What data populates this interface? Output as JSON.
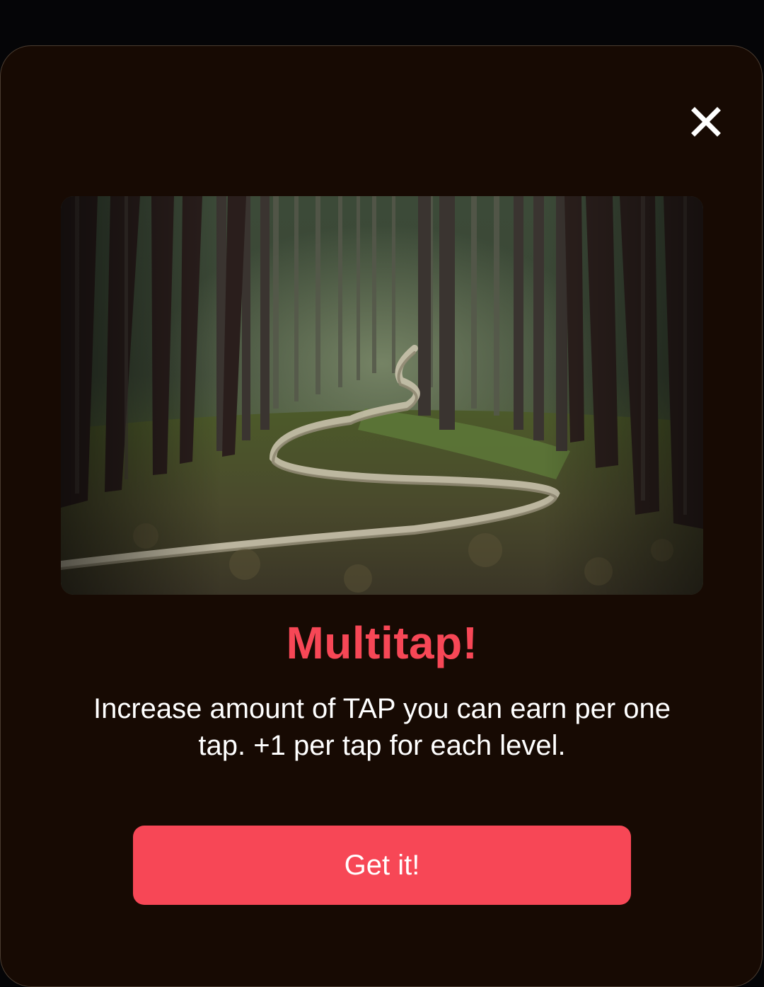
{
  "dialog": {
    "close_icon": "close-icon",
    "image_description_icon": "forest-path-image",
    "title": "Multitap!",
    "description": "Increase amount of TAP you can earn per one tap. +1 per tap for each level.",
    "cta_label": "Get it!",
    "colors": {
      "accent": "#f74756",
      "sheet_background": "#170a03",
      "backdrop": "#050507",
      "text": "#ffffff"
    }
  }
}
